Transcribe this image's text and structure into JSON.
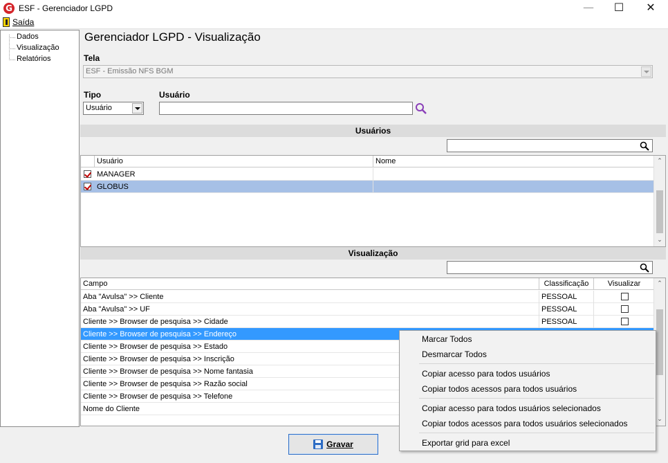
{
  "window": {
    "title": "ESF - Gerenciador LGPD",
    "minimize": "—",
    "maximize": "☐",
    "close": "✕",
    "app_icon": "G"
  },
  "menu": {
    "saida": "Saída"
  },
  "tree": {
    "items": [
      "Dados",
      "Visualização",
      "Relatórios"
    ]
  },
  "page": {
    "title": "Gerenciador LGPD - Visualização"
  },
  "filters": {
    "tela_label": "Tela",
    "tela_value": "ESF - Emissão NFS BGM",
    "tipo_label": "Tipo",
    "tipo_value": "Usuário",
    "usuario_label": "Usuário",
    "usuario_value": ""
  },
  "usuarios": {
    "section_title": "Usuários",
    "filter_value": "",
    "columns": [
      "Usuário",
      "Nome"
    ],
    "rows": [
      {
        "usuario": "MANAGER",
        "nome": "",
        "checked": true
      },
      {
        "usuario": "GLOBUS",
        "nome": "",
        "checked": true
      }
    ]
  },
  "visualizacao": {
    "section_title": "Visualização",
    "filter_value": "",
    "columns": [
      "Campo",
      "Classificação",
      "Visualizar"
    ],
    "rows": [
      {
        "campo": "Aba \"Avulsa\" >> Cliente",
        "classificacao": "PESSOAL",
        "visualizar": false
      },
      {
        "campo": "Aba \"Avulsa\" >> UF",
        "classificacao": "PESSOAL",
        "visualizar": false
      },
      {
        "campo": "Cliente >> Browser de pesquisa >> Cidade",
        "classificacao": "PESSOAL",
        "visualizar": false
      },
      {
        "campo": "Cliente >> Browser de pesquisa >> Endereço",
        "classificacao": "",
        "visualizar": null
      },
      {
        "campo": "Cliente >> Browser de pesquisa >> Estado",
        "classificacao": "",
        "visualizar": null
      },
      {
        "campo": "Cliente >> Browser de pesquisa >> Inscrição",
        "classificacao": "",
        "visualizar": null
      },
      {
        "campo": "Cliente >> Browser de pesquisa >> Nome fantasia",
        "classificacao": "",
        "visualizar": null
      },
      {
        "campo": "Cliente >> Browser de pesquisa >> Razão social",
        "classificacao": "",
        "visualizar": null
      },
      {
        "campo": "Cliente >> Browser de pesquisa >> Telefone",
        "classificacao": "",
        "visualizar": null
      },
      {
        "campo": "Nome do Cliente",
        "classificacao": "",
        "visualizar": null
      }
    ]
  },
  "actions": {
    "gravar": "Gravar"
  },
  "context_menu": {
    "items": [
      "Marcar Todos",
      "Desmarcar Todos",
      "Copiar acesso para todos usuários",
      "Copiar todos acessos para todos usuários",
      "Copiar acesso para todos usuários selecionados",
      "Copiar todos acessos para todos usuários selecionados",
      "Exportar grid para excel"
    ]
  },
  "colors": {
    "selection_strong": "#3399ff",
    "selection_soft": "#a6c0e6",
    "accent": "#2d6cc4",
    "search_icon": "#8a3fb8"
  }
}
